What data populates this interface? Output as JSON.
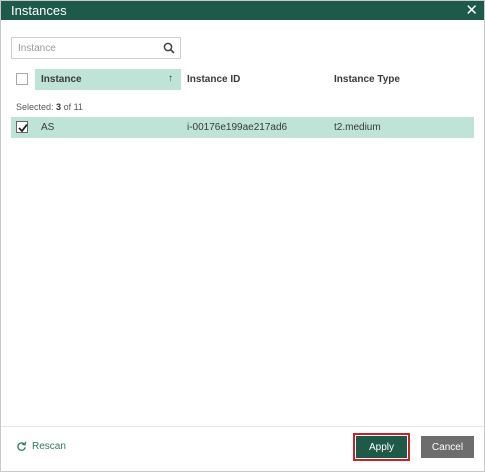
{
  "dialog": {
    "title": "Instances",
    "close_icon": "close-icon"
  },
  "search": {
    "placeholder": "Instance",
    "value": "",
    "icon": "search-icon"
  },
  "table": {
    "columns": [
      {
        "label": "Instance",
        "sorted": "ascending"
      },
      {
        "label": "Instance ID"
      },
      {
        "label": "Instance Type"
      }
    ],
    "selected_label": "Selected:",
    "selected_count": "3",
    "selected_of": "of 11",
    "rows": [
      {
        "name": "AS",
        "instance_id": "i-00176e199ae217ad6",
        "instance_type": "t2.medium",
        "checked": true
      }
    ]
  },
  "footer": {
    "rescan_label": "Rescan",
    "apply_label": "Apply",
    "cancel_label": "Cancel"
  },
  "colors": {
    "titlebar": "#1e5a4a",
    "selection": "#bfe3d6",
    "apply_button": "#1f5a49",
    "highlight_border": "#c8222b",
    "cancel_button": "#6d6d6d",
    "link": "#2d7a62"
  }
}
